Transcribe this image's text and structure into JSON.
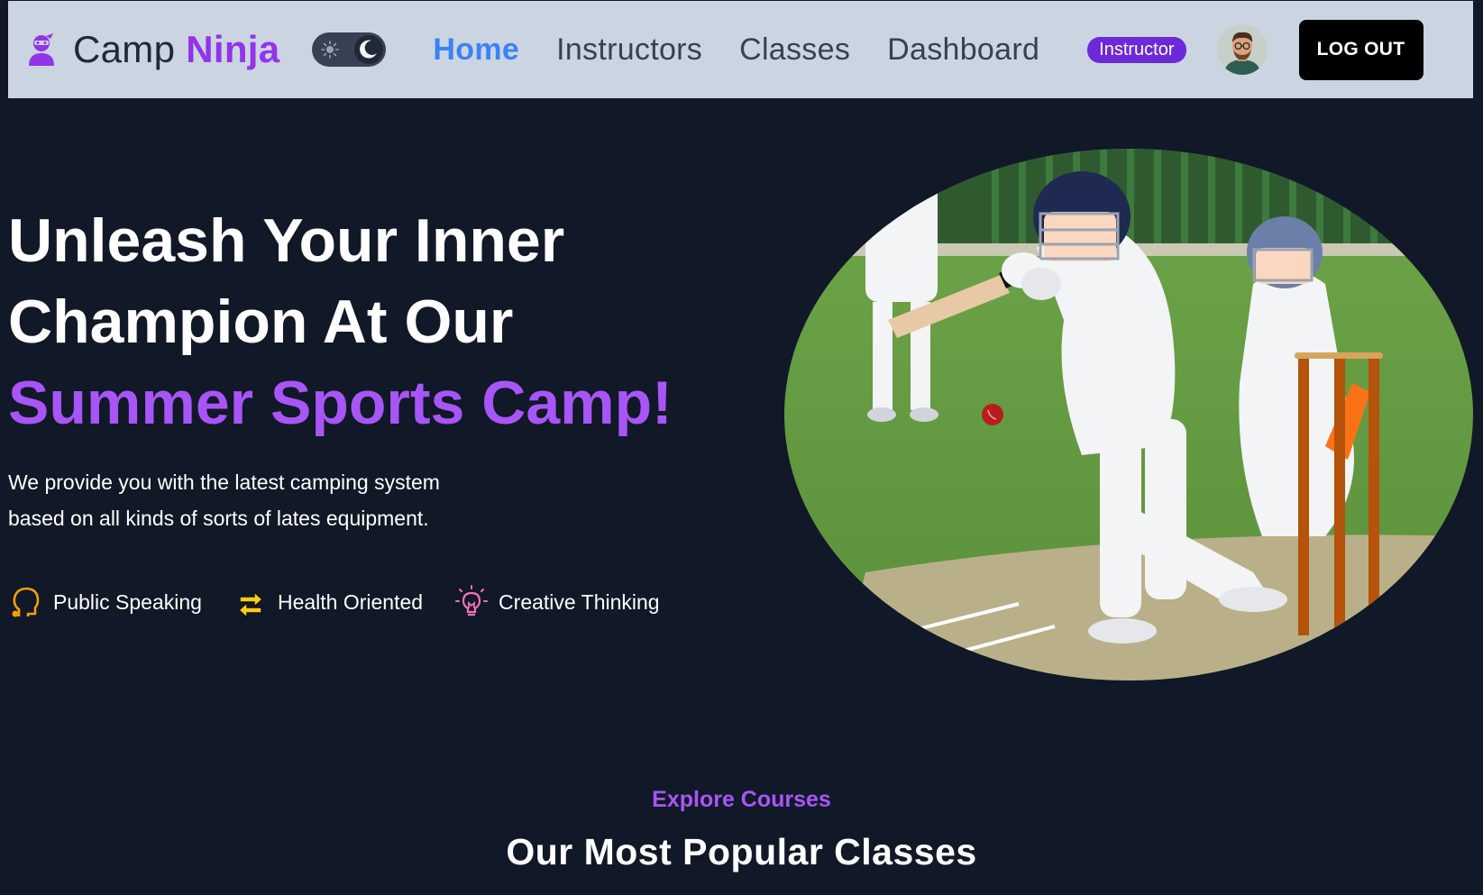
{
  "brand": {
    "prefix": "Camp",
    "accent": "Ninja",
    "icon": "ninja-icon"
  },
  "theme_toggle": {
    "icons": [
      "sun-icon",
      "moon-icon"
    ],
    "mode": "dark"
  },
  "nav": {
    "links": [
      {
        "label": "Home",
        "active": true
      },
      {
        "label": "Instructors",
        "active": false
      },
      {
        "label": "Classes",
        "active": false
      },
      {
        "label": "Dashboard",
        "active": false
      }
    ],
    "role_badge": "Instructor",
    "logout_label": "LOG OUT"
  },
  "hero": {
    "title_line1": "Unleash Your Inner",
    "title_line2": "Champion At Our",
    "title_accent": "Summer Sports Camp!",
    "desc_line1": "We provide you with the latest camping system",
    "desc_line2": "based on all kinds of sorts of lates equipment.",
    "features": [
      {
        "icon": "head-icon",
        "label": "Public Speaking"
      },
      {
        "icon": "arrows-icon",
        "label": "Health Oriented"
      },
      {
        "icon": "bulb-icon",
        "label": "Creative Thinking"
      }
    ]
  },
  "section": {
    "eyebrow": "Explore Courses",
    "title": "Our Most Popular Classes"
  },
  "colors": {
    "accent": "#a855f7",
    "nav_active": "#3b82f6",
    "background": "#111827",
    "navbar": "#cbd5e1",
    "badge": "#6d28d9"
  }
}
